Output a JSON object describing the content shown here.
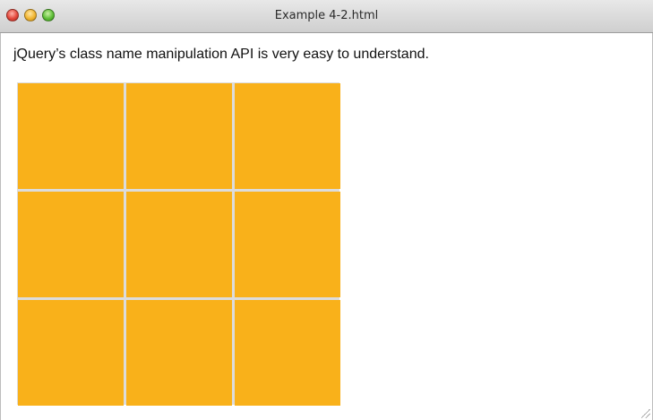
{
  "window": {
    "title": "Example 4-2.html",
    "controls": {
      "close": "close-button",
      "minimize": "minimize-button",
      "zoom": "zoom-button"
    }
  },
  "content": {
    "intro_text": "jQuery’s class name manipulation API is very easy to understand.",
    "grid": {
      "rows": 3,
      "columns": 3,
      "cell_color": "#f9b11a"
    }
  },
  "colors": {
    "cell": "#f9b11a",
    "grid_gap": "#dcdcdc"
  }
}
